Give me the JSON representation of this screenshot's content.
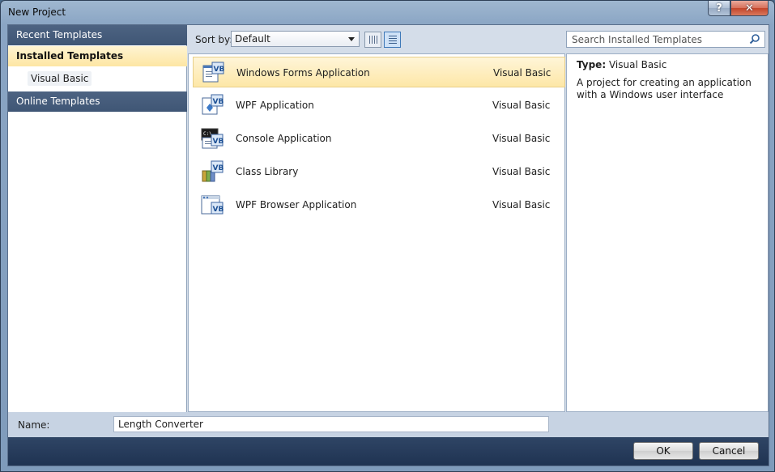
{
  "window": {
    "title": "New Project",
    "help_label": "?",
    "close_label": "✕"
  },
  "sidebar": {
    "recent": "Recent Templates",
    "installed": "Installed Templates",
    "installed_child": "Visual Basic",
    "online": "Online Templates"
  },
  "toolbar": {
    "sort_label": "Sort by:",
    "sort_value": "Default"
  },
  "search": {
    "placeholder": "Search Installed Templates"
  },
  "templates": [
    {
      "name": "Windows Forms Application",
      "language": "Visual Basic",
      "selected": true
    },
    {
      "name": "WPF Application",
      "language": "Visual Basic",
      "selected": false
    },
    {
      "name": "Console Application",
      "language": "Visual Basic",
      "selected": false
    },
    {
      "name": "Class Library",
      "language": "Visual Basic",
      "selected": false
    },
    {
      "name": "WPF Browser Application",
      "language": "Visual Basic",
      "selected": false
    }
  ],
  "details": {
    "type_label": "Type:",
    "type_value": "Visual Basic",
    "description": "A project for creating an application with a Windows user interface"
  },
  "form": {
    "name_label": "Name:",
    "name_value": "Length Converter"
  },
  "buttons": {
    "ok": "OK",
    "cancel": "Cancel"
  },
  "colors": {
    "selection": "#fde7a7",
    "header": "#3f5675",
    "footer": "#1f3352"
  }
}
